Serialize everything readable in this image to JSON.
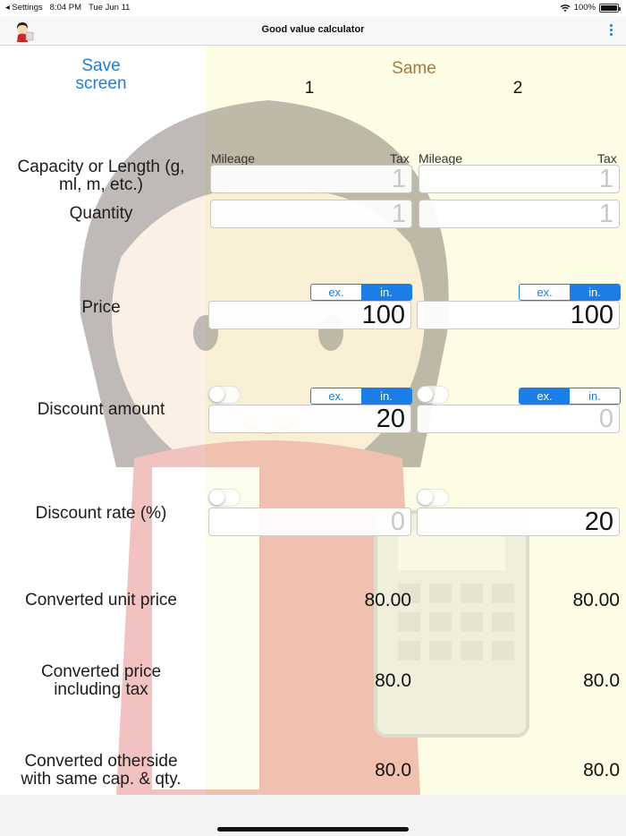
{
  "status": {
    "carrier": "◂ Settings",
    "time": "8:04 PM",
    "date": "Tue Jun 11",
    "battery": "100%"
  },
  "nav": {
    "title": "Good value calculator"
  },
  "header": {
    "save_line1": "Save",
    "save_line2": "screen",
    "same": "Same",
    "col1": "1",
    "col2": "2"
  },
  "rows": {
    "capacity_line1": "Capacity or Length (g,",
    "capacity_line2": "ml, m, etc.)",
    "quantity": "Quantity",
    "price": "Price",
    "discount_amount": "Discount amount",
    "discount_rate": "Discount rate (%)",
    "unit_price": "Converted  unit price",
    "price_incl_line1": "Converted price",
    "price_incl_line2": "including tax",
    "otherside_line1": "Converted otherside",
    "otherside_line2": "with same cap. & qty."
  },
  "col1": {
    "mileage": "Mileage",
    "tax": "Tax",
    "capacity": "1",
    "quantity": "1",
    "price": "100",
    "price_seg": [
      "ex.",
      "in."
    ],
    "price_selected": "in.",
    "discount_amount": "20",
    "discount_seg": [
      "ex.",
      "in."
    ],
    "discount_selected": "in.",
    "discount_rate": "0",
    "unit_price": "80.00",
    "price_incl": "80.0",
    "otherside": "80.0"
  },
  "col2": {
    "mileage": "Mileage",
    "tax": "Tax",
    "capacity": "1",
    "quantity": "1",
    "price": "100",
    "price_seg": [
      "ex.",
      "in."
    ],
    "price_selected": "in.",
    "discount_amount": "0",
    "discount_seg": [
      "ex.",
      "in."
    ],
    "discount_selected": "ex.",
    "discount_rate": "20",
    "unit_price": "80.00",
    "price_incl": "80.0",
    "otherside": "80.0"
  },
  "colors": {
    "accent": "#1a7ee6",
    "same": "#a57a40",
    "panel": "#fdfde6"
  },
  "icons": {
    "menu": "more-vertical-icon",
    "avatar": "app-mascot-icon",
    "wifi": "wifi-icon",
    "battery": "battery-icon"
  }
}
